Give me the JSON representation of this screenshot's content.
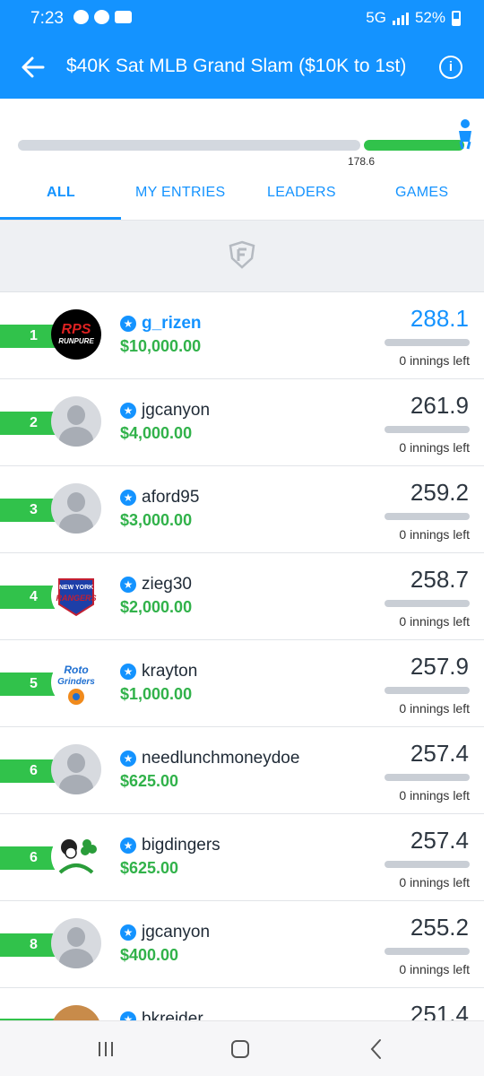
{
  "status_bar": {
    "time": "7:23",
    "network": "5G",
    "battery": "52%"
  },
  "header": {
    "title": "$40K Sat MLB Grand Slam ($10K to 1st)"
  },
  "progress": {
    "label": "178.6",
    "fraction_complete": 0.78
  },
  "tabs": [
    {
      "label": "ALL"
    },
    {
      "label": "MY ENTRIES"
    },
    {
      "label": "LEADERS"
    },
    {
      "label": "GAMES"
    }
  ],
  "entries": [
    {
      "rank": "1",
      "username": "g_rizen",
      "prize": "$10,000.00",
      "score": "288.1",
      "innings": "0 innings left",
      "avatar_logo": "RPS RUNPURE"
    },
    {
      "rank": "2",
      "username": "jgcanyon",
      "prize": "$4,000.00",
      "score": "261.9",
      "innings": "0 innings left"
    },
    {
      "rank": "3",
      "username": "aford95",
      "prize": "$3,000.00",
      "score": "259.2",
      "innings": "0 innings left"
    },
    {
      "rank": "4",
      "username": "zieg30",
      "prize": "$2,000.00",
      "score": "258.7",
      "innings": "0 innings left",
      "avatar_logo": "NEW YORK RANGERS"
    },
    {
      "rank": "5",
      "username": "krayton",
      "prize": "$1,000.00",
      "score": "257.9",
      "innings": "0 innings left",
      "avatar_logo": "Roto Grinders"
    },
    {
      "rank": "6",
      "username": "needlunchmoneydoe",
      "prize": "$625.00",
      "score": "257.4",
      "innings": "0 innings left"
    },
    {
      "rank": "6",
      "username": "bigdingers",
      "prize": "$625.00",
      "score": "257.4",
      "innings": "0 innings left"
    },
    {
      "rank": "8",
      "username": "jgcanyon",
      "prize": "$400.00",
      "score": "255.2",
      "innings": "0 innings left"
    },
    {
      "rank": "",
      "username": "bkreider",
      "prize": "",
      "score": "251.4",
      "innings": ""
    }
  ],
  "colors": {
    "brand_blue": "#1493ff",
    "green": "#31c24b",
    "prize_green": "#31b24a"
  }
}
